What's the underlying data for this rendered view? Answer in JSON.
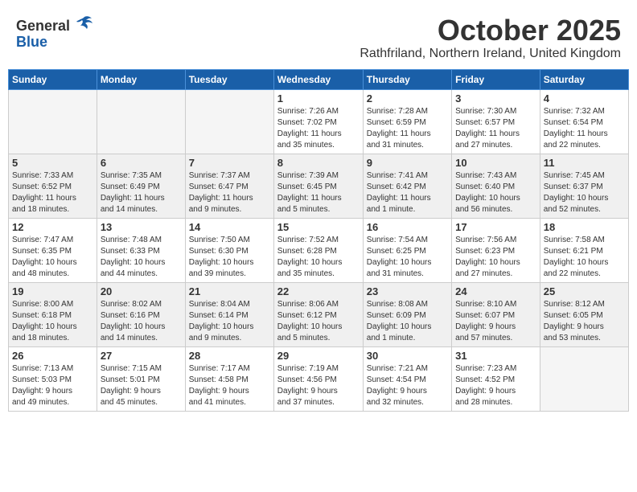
{
  "logo": {
    "general": "General",
    "blue": "Blue"
  },
  "title": "October 2025",
  "location": "Rathfriland, Northern Ireland, United Kingdom",
  "days_of_week": [
    "Sunday",
    "Monday",
    "Tuesday",
    "Wednesday",
    "Thursday",
    "Friday",
    "Saturday"
  ],
  "weeks": [
    [
      {
        "num": "",
        "info": ""
      },
      {
        "num": "",
        "info": ""
      },
      {
        "num": "",
        "info": ""
      },
      {
        "num": "1",
        "info": "Sunrise: 7:26 AM\nSunset: 7:02 PM\nDaylight: 11 hours\nand 35 minutes."
      },
      {
        "num": "2",
        "info": "Sunrise: 7:28 AM\nSunset: 6:59 PM\nDaylight: 11 hours\nand 31 minutes."
      },
      {
        "num": "3",
        "info": "Sunrise: 7:30 AM\nSunset: 6:57 PM\nDaylight: 11 hours\nand 27 minutes."
      },
      {
        "num": "4",
        "info": "Sunrise: 7:32 AM\nSunset: 6:54 PM\nDaylight: 11 hours\nand 22 minutes."
      }
    ],
    [
      {
        "num": "5",
        "info": "Sunrise: 7:33 AM\nSunset: 6:52 PM\nDaylight: 11 hours\nand 18 minutes."
      },
      {
        "num": "6",
        "info": "Sunrise: 7:35 AM\nSunset: 6:49 PM\nDaylight: 11 hours\nand 14 minutes."
      },
      {
        "num": "7",
        "info": "Sunrise: 7:37 AM\nSunset: 6:47 PM\nDaylight: 11 hours\nand 9 minutes."
      },
      {
        "num": "8",
        "info": "Sunrise: 7:39 AM\nSunset: 6:45 PM\nDaylight: 11 hours\nand 5 minutes."
      },
      {
        "num": "9",
        "info": "Sunrise: 7:41 AM\nSunset: 6:42 PM\nDaylight: 11 hours\nand 1 minute."
      },
      {
        "num": "10",
        "info": "Sunrise: 7:43 AM\nSunset: 6:40 PM\nDaylight: 10 hours\nand 56 minutes."
      },
      {
        "num": "11",
        "info": "Sunrise: 7:45 AM\nSunset: 6:37 PM\nDaylight: 10 hours\nand 52 minutes."
      }
    ],
    [
      {
        "num": "12",
        "info": "Sunrise: 7:47 AM\nSunset: 6:35 PM\nDaylight: 10 hours\nand 48 minutes."
      },
      {
        "num": "13",
        "info": "Sunrise: 7:48 AM\nSunset: 6:33 PM\nDaylight: 10 hours\nand 44 minutes."
      },
      {
        "num": "14",
        "info": "Sunrise: 7:50 AM\nSunset: 6:30 PM\nDaylight: 10 hours\nand 39 minutes."
      },
      {
        "num": "15",
        "info": "Sunrise: 7:52 AM\nSunset: 6:28 PM\nDaylight: 10 hours\nand 35 minutes."
      },
      {
        "num": "16",
        "info": "Sunrise: 7:54 AM\nSunset: 6:25 PM\nDaylight: 10 hours\nand 31 minutes."
      },
      {
        "num": "17",
        "info": "Sunrise: 7:56 AM\nSunset: 6:23 PM\nDaylight: 10 hours\nand 27 minutes."
      },
      {
        "num": "18",
        "info": "Sunrise: 7:58 AM\nSunset: 6:21 PM\nDaylight: 10 hours\nand 22 minutes."
      }
    ],
    [
      {
        "num": "19",
        "info": "Sunrise: 8:00 AM\nSunset: 6:18 PM\nDaylight: 10 hours\nand 18 minutes."
      },
      {
        "num": "20",
        "info": "Sunrise: 8:02 AM\nSunset: 6:16 PM\nDaylight: 10 hours\nand 14 minutes."
      },
      {
        "num": "21",
        "info": "Sunrise: 8:04 AM\nSunset: 6:14 PM\nDaylight: 10 hours\nand 9 minutes."
      },
      {
        "num": "22",
        "info": "Sunrise: 8:06 AM\nSunset: 6:12 PM\nDaylight: 10 hours\nand 5 minutes."
      },
      {
        "num": "23",
        "info": "Sunrise: 8:08 AM\nSunset: 6:09 PM\nDaylight: 10 hours\nand 1 minute."
      },
      {
        "num": "24",
        "info": "Sunrise: 8:10 AM\nSunset: 6:07 PM\nDaylight: 9 hours\nand 57 minutes."
      },
      {
        "num": "25",
        "info": "Sunrise: 8:12 AM\nSunset: 6:05 PM\nDaylight: 9 hours\nand 53 minutes."
      }
    ],
    [
      {
        "num": "26",
        "info": "Sunrise: 7:13 AM\nSunset: 5:03 PM\nDaylight: 9 hours\nand 49 minutes."
      },
      {
        "num": "27",
        "info": "Sunrise: 7:15 AM\nSunset: 5:01 PM\nDaylight: 9 hours\nand 45 minutes."
      },
      {
        "num": "28",
        "info": "Sunrise: 7:17 AM\nSunset: 4:58 PM\nDaylight: 9 hours\nand 41 minutes."
      },
      {
        "num": "29",
        "info": "Sunrise: 7:19 AM\nSunset: 4:56 PM\nDaylight: 9 hours\nand 37 minutes."
      },
      {
        "num": "30",
        "info": "Sunrise: 7:21 AM\nSunset: 4:54 PM\nDaylight: 9 hours\nand 32 minutes."
      },
      {
        "num": "31",
        "info": "Sunrise: 7:23 AM\nSunset: 4:52 PM\nDaylight: 9 hours\nand 28 minutes."
      },
      {
        "num": "",
        "info": ""
      }
    ]
  ]
}
